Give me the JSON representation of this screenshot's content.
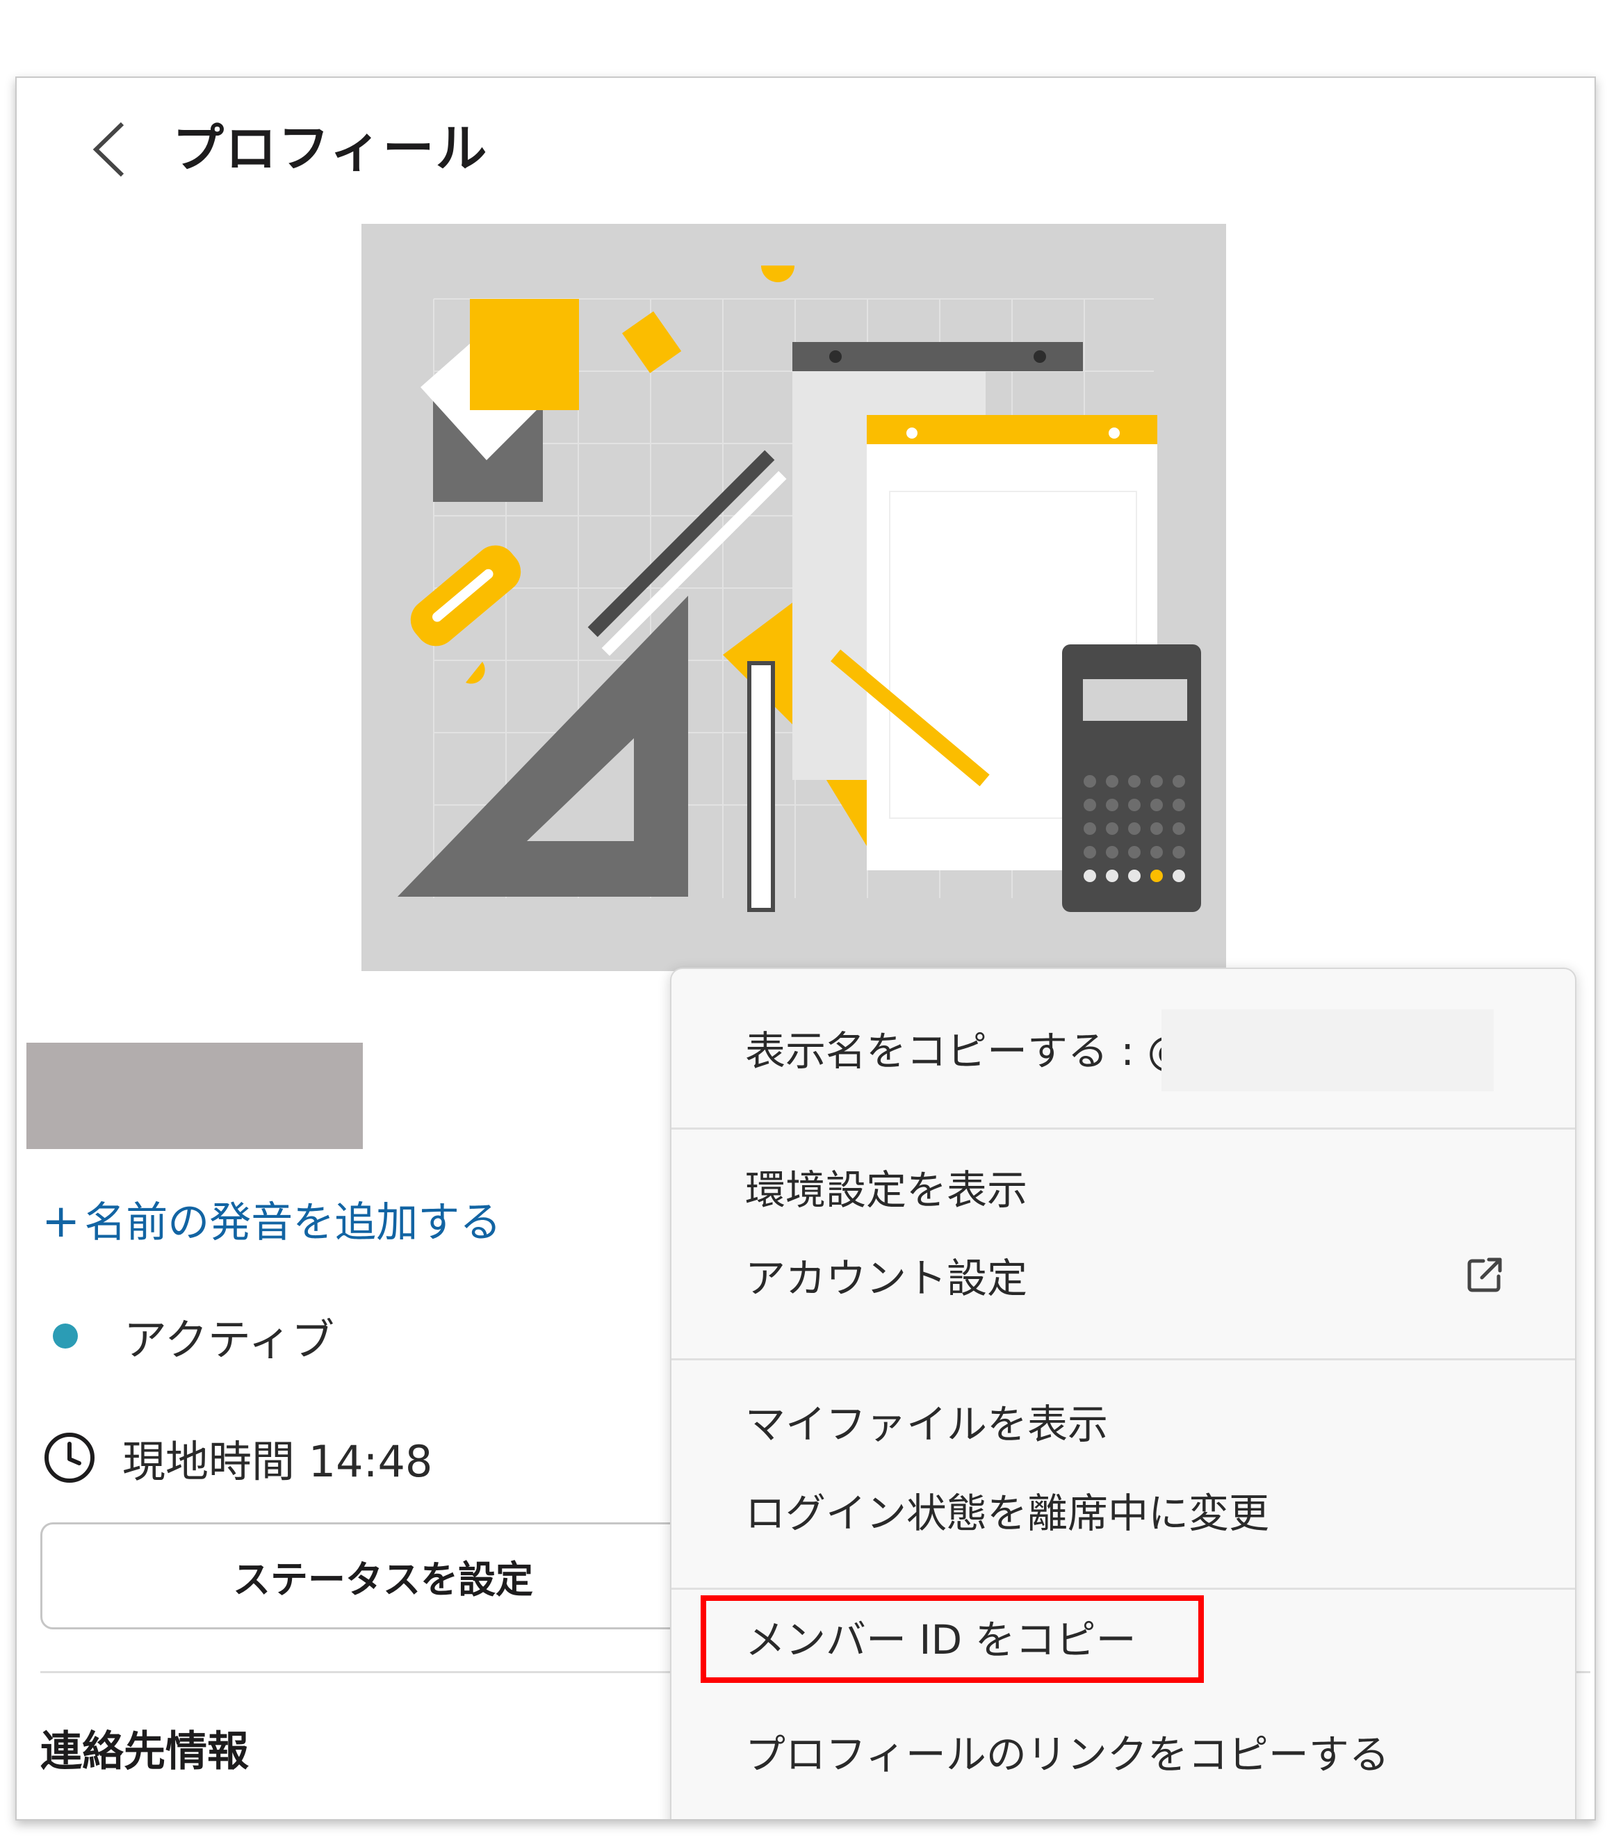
{
  "header": {
    "title": "プロフィール",
    "back_icon": "chevron-left-icon"
  },
  "profile": {
    "add_pronunciation_plus": "+",
    "add_pronunciation": "名前の発音を追加する",
    "status": "アクティブ",
    "status_color": "#2b9cb5",
    "local_time_label": "現地時間 14:48",
    "set_status_button": "ステータスを設定",
    "contact_heading": "連絡先情報"
  },
  "menu": {
    "copy_display_name": "表示名をコピーする : @",
    "view_preferences": "環境設定を表示",
    "account_settings": "アカウント設定",
    "account_settings_icon": "external-link-icon",
    "view_my_files": "マイファイルを表示",
    "set_away": "ログイン状態を離席中に変更",
    "copy_member_id": "メンバー ID をコピー",
    "copy_profile_link": "プロフィールのリンクをコピーする"
  },
  "colors": {
    "link": "#1264a3",
    "highlight": "#ff0000",
    "accent": "#fbbd00"
  }
}
